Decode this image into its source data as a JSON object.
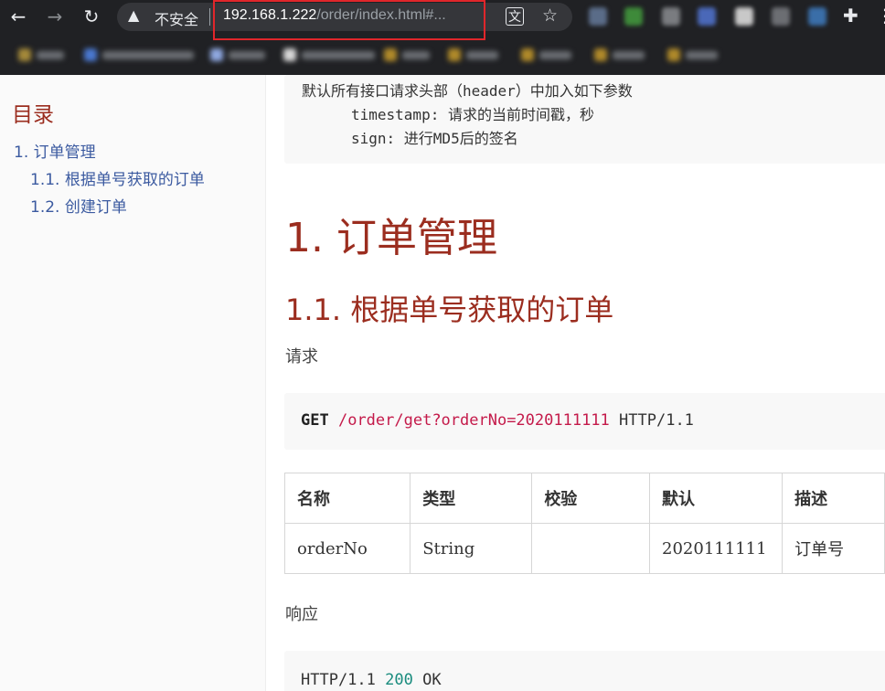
{
  "browser": {
    "security_label": "不安全",
    "url_host": "192.168.1.222",
    "url_path": "/order/index.html#..."
  },
  "toc": {
    "title": "目录",
    "items": [
      {
        "label": "1. 订单管理"
      },
      {
        "label": "1.1. 根据单号获取的订单"
      },
      {
        "label": "1.2. 创建订单"
      }
    ]
  },
  "content": {
    "header_note": {
      "line1": "默认所有接口请求头部（header）中加入如下参数",
      "line2_key": "timestamp",
      "line2_desc": ": 请求的当前时间戳，秒",
      "line3_key": "sign",
      "line3_desc": ": 进行MD5后的签名"
    },
    "h1": "1. 订单管理",
    "h2": "1.1. 根据单号获取的订单",
    "request_label": "请求",
    "request": {
      "method": "GET",
      "path": "/order/get?orderNo=2020111111",
      "protocol": "HTTP/1.1"
    },
    "table": {
      "headers": [
        "名称",
        "类型",
        "校验",
        "默认",
        "描述"
      ],
      "rows": [
        [
          "orderNo",
          "String",
          "",
          "2020111111",
          "订单号"
        ]
      ]
    },
    "response_label": "响应",
    "response": {
      "protocol": "HTTP/1.1",
      "status_code": "200",
      "status_text": "OK"
    }
  }
}
